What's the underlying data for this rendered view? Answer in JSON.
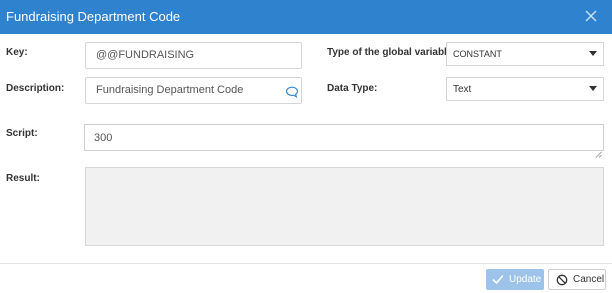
{
  "dialog": {
    "title": "Fundraising Department Code"
  },
  "form": {
    "key_label": "Key:",
    "key_value": "@@FUNDRAISING",
    "description_label": "Description:",
    "description_value": "Fundraising Department Code",
    "type_label": "Type of the global variable:",
    "type_value": "CONSTANT",
    "datatype_label": "Data Type:",
    "datatype_value": "Text",
    "script_label": "Script:",
    "script_value": "300",
    "result_label": "Result:",
    "result_value": ""
  },
  "footer": {
    "update_label": "Update",
    "cancel_label": "Cancel"
  },
  "icons": {
    "close": "close-icon",
    "comment": "comment-icon",
    "check": "check-icon",
    "cancel": "cancel-circle-icon",
    "dropdown": "chevron-down-icon"
  },
  "colors": {
    "titlebar": "#2f82cd",
    "update_button": "#9dc3ea",
    "result_background": "#f1f1f1"
  }
}
